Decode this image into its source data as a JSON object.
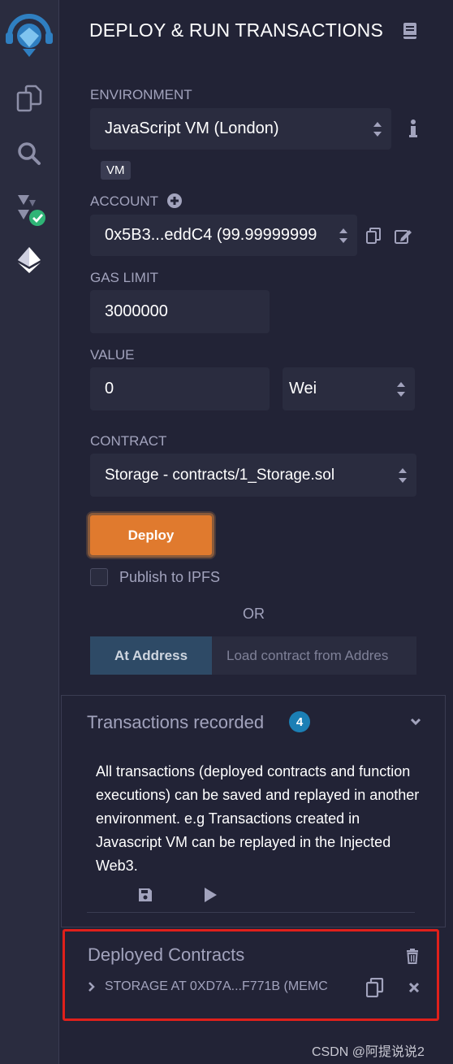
{
  "header": {
    "title": "DEPLOY & RUN TRANSACTIONS"
  },
  "environment": {
    "label": "ENVIRONMENT",
    "value": "JavaScript VM (London)",
    "badge": "VM"
  },
  "account": {
    "label": "ACCOUNT",
    "value": "0x5B3...eddC4 (99.99999999"
  },
  "gas_limit": {
    "label": "GAS LIMIT",
    "value": "3000000"
  },
  "value": {
    "label": "VALUE",
    "amount": "0",
    "unit": "Wei"
  },
  "contract": {
    "label": "CONTRACT",
    "value": "Storage - contracts/1_Storage.sol"
  },
  "deploy": {
    "button": "Deploy",
    "publish_label": "Publish to IPFS",
    "or": "OR"
  },
  "at_address": {
    "button": "At Address",
    "placeholder": "Load contract from Addres"
  },
  "transactions": {
    "title": "Transactions recorded",
    "count": "4",
    "description": "All transactions (deployed contracts and function executions) can be saved and replayed in another environment. e.g Transactions created in Javascript VM can be replayed in the Injected Web3."
  },
  "deployed": {
    "title": "Deployed Contracts",
    "instance": "STORAGE AT 0XD7A...F771B (MEMC"
  },
  "watermark": "CSDN @阿提说说2",
  "colors": {
    "accent": "#e07a2e",
    "highlight": "#e0201b",
    "panel_bg": "#222336",
    "field_bg": "#2a2c3f"
  }
}
